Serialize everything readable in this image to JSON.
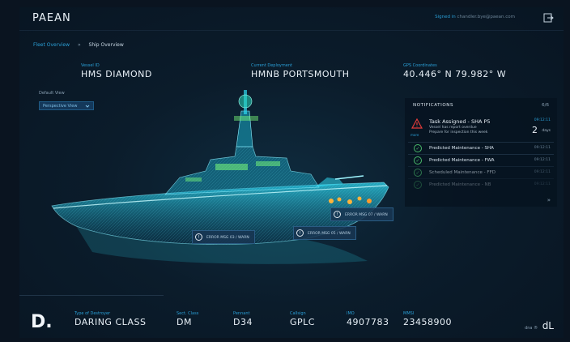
{
  "app": {
    "logo": "PAEAN"
  },
  "user": {
    "prefix": "Signed in",
    "email": "chandler.bye@paean.com"
  },
  "breadcrumb": {
    "first": "Fleet Overview",
    "sep": "»",
    "current": "Ship Overview"
  },
  "vessel": {
    "id_label": "Vessel ID",
    "id_value": "HMS DIAMOND",
    "deployment_label": "Current Deployment",
    "deployment_value": "HMNB PORTSMOUTH",
    "gps_label": "GPS Coordinates",
    "gps_value": "40.446° N 79.982° W"
  },
  "view": {
    "label": "Default View",
    "selected": "Perspective View"
  },
  "callouts": [
    {
      "text": "ERROR MSG 07 / WARN"
    },
    {
      "text": "ERROR MSG 03 / WARN"
    },
    {
      "text": "ERROR MSG 05 / WARN"
    }
  ],
  "notifications": {
    "header": "NOTIFICATIONS",
    "count": "6/6",
    "alert": {
      "title": "Task Assigned - SHA P5",
      "line1": "Vessel has report overdue",
      "line2": "Prepare for inspection this week",
      "more": "more",
      "time": "09:12:11",
      "value": "2",
      "unit": "days"
    },
    "items": [
      {
        "text": "Predicted Maintenance - SHA",
        "time": "09:12:11"
      },
      {
        "text": "Predicted Maintenance - FWA",
        "time": "09:12:11"
      },
      {
        "text": "Scheduled Maintenance - FFD",
        "time": "09:12:11"
      },
      {
        "text": "Predicted Maintenance - NB",
        "time": "09:12:11"
      }
    ],
    "expand": "»"
  },
  "bottom": {
    "letter": "D.",
    "type_label": "Type of Destroyer",
    "type_value": "DARING CLASS",
    "code_label": "Sect. Class",
    "code_value": "DM",
    "pennant_label": "Pennant",
    "pennant_value": "D34",
    "callsign_label": "Callsign",
    "callsign_value": "GPLC",
    "imo_label": "IMO",
    "imo_value": "4907783",
    "mmsi_label": "MMSI",
    "mmsi_value": "23458900",
    "brand_prefix": "dna ®",
    "brand": "dL"
  },
  "colors": {
    "accent": "#2a9fd6",
    "ship": "#1ec8e6",
    "warning": "#e23b3b",
    "success": "#49b96a"
  }
}
